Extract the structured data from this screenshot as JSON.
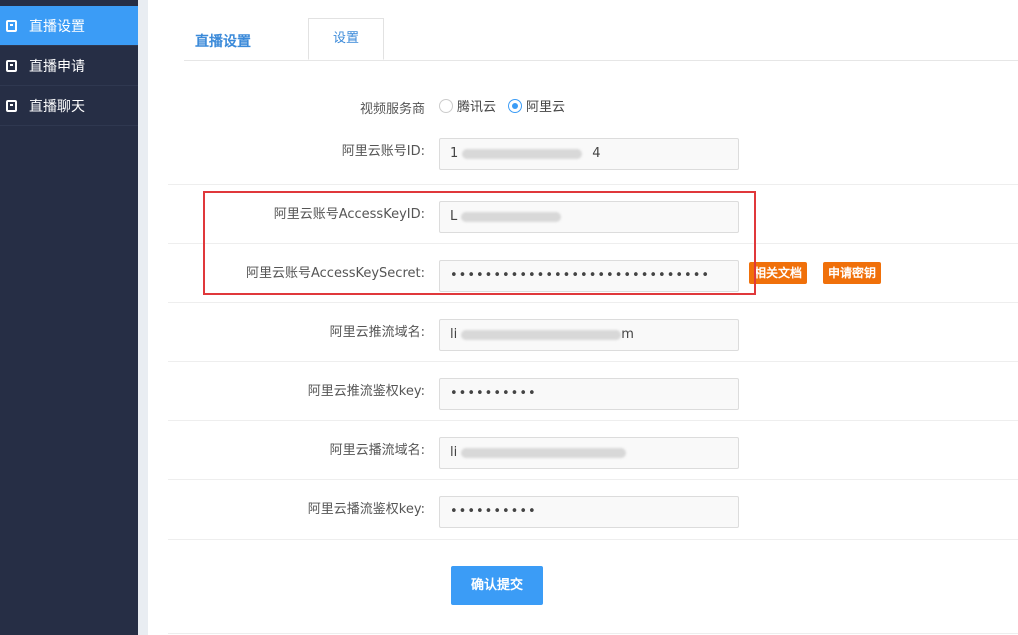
{
  "sidebar": {
    "items": [
      {
        "label": "直播设置",
        "active": true
      },
      {
        "label": "直播申请",
        "active": false
      },
      {
        "label": "直播聊天",
        "active": false
      }
    ]
  },
  "tabs": {
    "title": "直播设置",
    "settings": "设置"
  },
  "form": {
    "provider": {
      "label": "视频服务商",
      "options": [
        "腾讯云",
        "阿里云"
      ],
      "selected": "阿里云"
    },
    "account_id": {
      "label": "阿里云账号ID:",
      "value_prefix": "1",
      "value_suffix": "4"
    },
    "access_key_id": {
      "label": "阿里云账号AccessKeyID:",
      "value_prefix": "L"
    },
    "access_key_secret": {
      "label": "阿里云账号AccessKeySecret:",
      "value": "••••••••••••••••••••••••••••••"
    },
    "push_domain": {
      "label": "阿里云推流域名:",
      "value_prefix": "li",
      "value_suffix": "m"
    },
    "push_auth_key": {
      "label": "阿里云推流鉴权key:",
      "value": "••••••••••"
    },
    "play_domain": {
      "label": "阿里云播流域名:",
      "value_prefix": "li"
    },
    "play_auth_key": {
      "label": "阿里云播流鉴权key:",
      "value": "••••••••••"
    }
  },
  "buttons": {
    "docs": "相关文档",
    "apply_key": "申请密钥",
    "submit": "确认提交"
  },
  "colors": {
    "sidebar_bg": "#262e45",
    "sidebar_active": "#3b9cf6",
    "accent": "#3b9cf6",
    "orange": "#f0700a",
    "highlight": "#e0383b"
  }
}
